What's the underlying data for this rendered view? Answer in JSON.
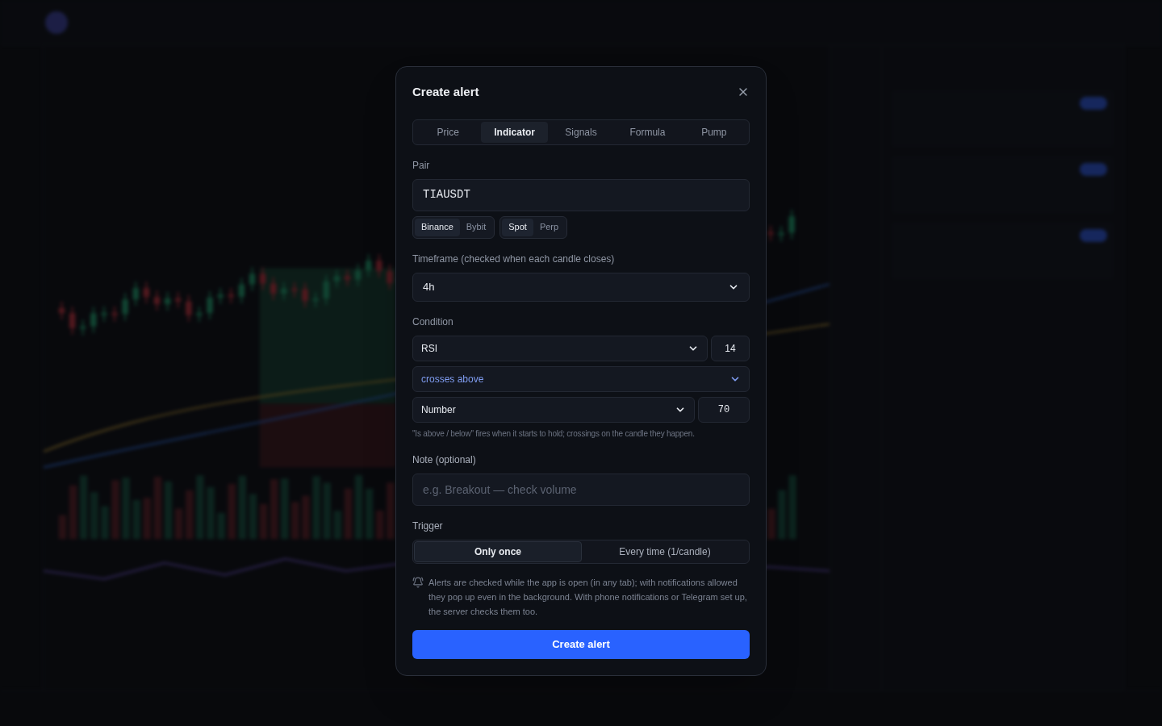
{
  "dialog": {
    "title": "Create alert"
  },
  "tabs": [
    {
      "label": "Price",
      "selected": false
    },
    {
      "label": "Indicator",
      "selected": true
    },
    {
      "label": "Signals",
      "selected": false
    },
    {
      "label": "Formula",
      "selected": false
    },
    {
      "label": "Pump",
      "selected": false
    }
  ],
  "pair": {
    "label": "Pair",
    "value": "TIAUSDT"
  },
  "exchanges": [
    {
      "label": "Binance",
      "selected": true
    },
    {
      "label": "Bybit",
      "selected": false
    }
  ],
  "markets": [
    {
      "label": "Spot",
      "selected": true
    },
    {
      "label": "Perp",
      "selected": false
    }
  ],
  "timeframe": {
    "label": "Timeframe (checked when each candle closes)",
    "value": "4h"
  },
  "condition": {
    "label": "Condition",
    "indicator": "RSI",
    "period": "14",
    "operator": "crosses above",
    "target": "Number",
    "target_value": "70",
    "hint": "\"Is above / below\" fires when it starts to hold; crossings on the candle they happen."
  },
  "note": {
    "label": "Note (optional)",
    "placeholder": "e.g. Breakout — check volume"
  },
  "trigger": {
    "label": "Trigger",
    "options": [
      {
        "label": "Only once",
        "selected": true
      },
      {
        "label": "Every time (1/candle)",
        "selected": false
      }
    ]
  },
  "info": "Alerts are checked while the app is open (in any tab); with notifications allowed they pop up even in the background. With phone notifications or Telegram set up, the server checks them too.",
  "submit": "Create alert"
}
